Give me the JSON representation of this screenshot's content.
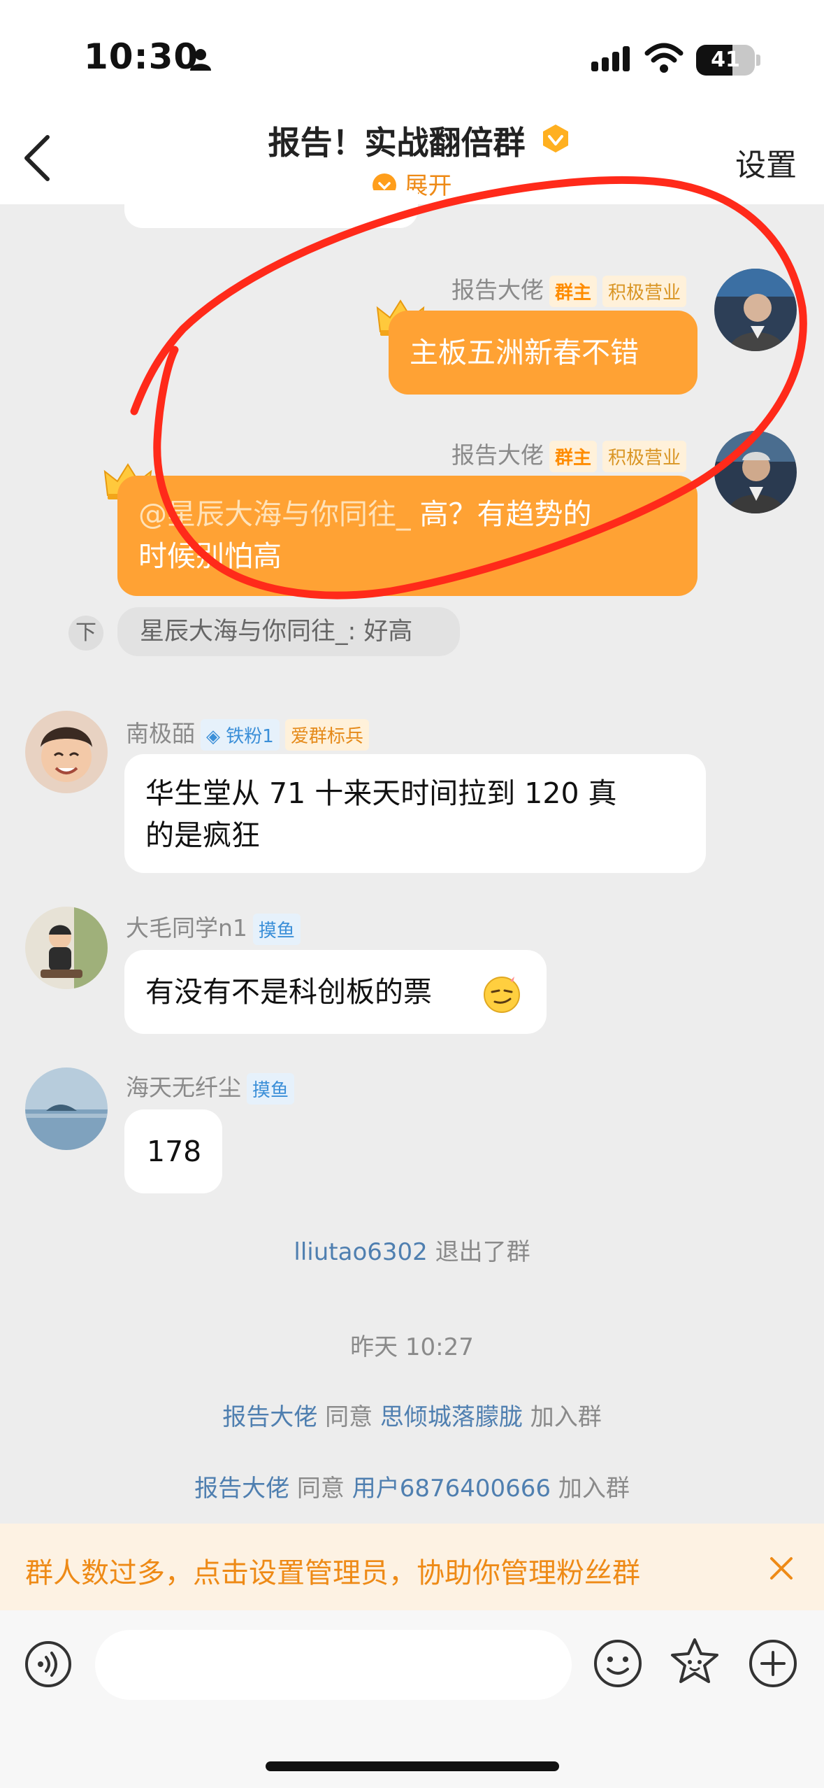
{
  "status_bar": {
    "time": "10:30",
    "battery": "41"
  },
  "header": {
    "title": "报告！实战翻倍群",
    "expand": "展开",
    "settings": "设置"
  },
  "messages": {
    "m1": {
      "name": "报告大佬",
      "tag_owner": "群主",
      "tag_active": "积极营业",
      "text": "主板五洲新春不错"
    },
    "m2": {
      "name": "报告大佬",
      "tag_owner": "群主",
      "tag_active": "积极营业",
      "mention": "@星辰大海与你同往_",
      "line1_rest": " 高？有趋势的",
      "line2": "时候别怕高"
    },
    "quote": {
      "icon": "下",
      "text": "星辰大海与你同往_: 好高"
    },
    "m3": {
      "name": "南极皕",
      "tag_fan": "铁粉1",
      "tag_loyal": "爱群标兵",
      "line1": "华生堂从 71 十来天时间拉到 120 真",
      "line2": "的是疯狂"
    },
    "m4": {
      "name": "大毛同学n1",
      "tag": "摸鱼",
      "text": "有没有不是科创板的票"
    },
    "m5": {
      "name": "海天无纤尘",
      "tag": "摸鱼",
      "text": "178"
    }
  },
  "system": {
    "left": {
      "user": "lliutao6302",
      "action": "退出了群"
    },
    "timestamp": "昨天 10:27",
    "join1": {
      "admin": "报告大佬",
      "verb": "同意",
      "user": "思倾城落朦胧",
      "action": "加入群"
    },
    "join2": {
      "admin": "报告大佬",
      "verb": "同意",
      "user": "用户6876400666",
      "action": "加入群"
    }
  },
  "banner": {
    "part1": "群人数过多，点击",
    "link": "设置管理员",
    "part2": "，协助你管理粉丝群"
  },
  "colors": {
    "accent": "#ffa234",
    "banner_text": "#ee8a16",
    "annotation": "#ff2a1a",
    "link": "#4f7fb0"
  },
  "icons": [
    "back-arrow-icon",
    "verified-badge-icon",
    "chevron-down-icon",
    "crown-icon",
    "voice-icon",
    "emoji-icon",
    "sticker-icon",
    "plus-icon",
    "close-icon",
    "wifi-icon",
    "signal-icon",
    "battery-icon",
    "person-icon"
  ]
}
